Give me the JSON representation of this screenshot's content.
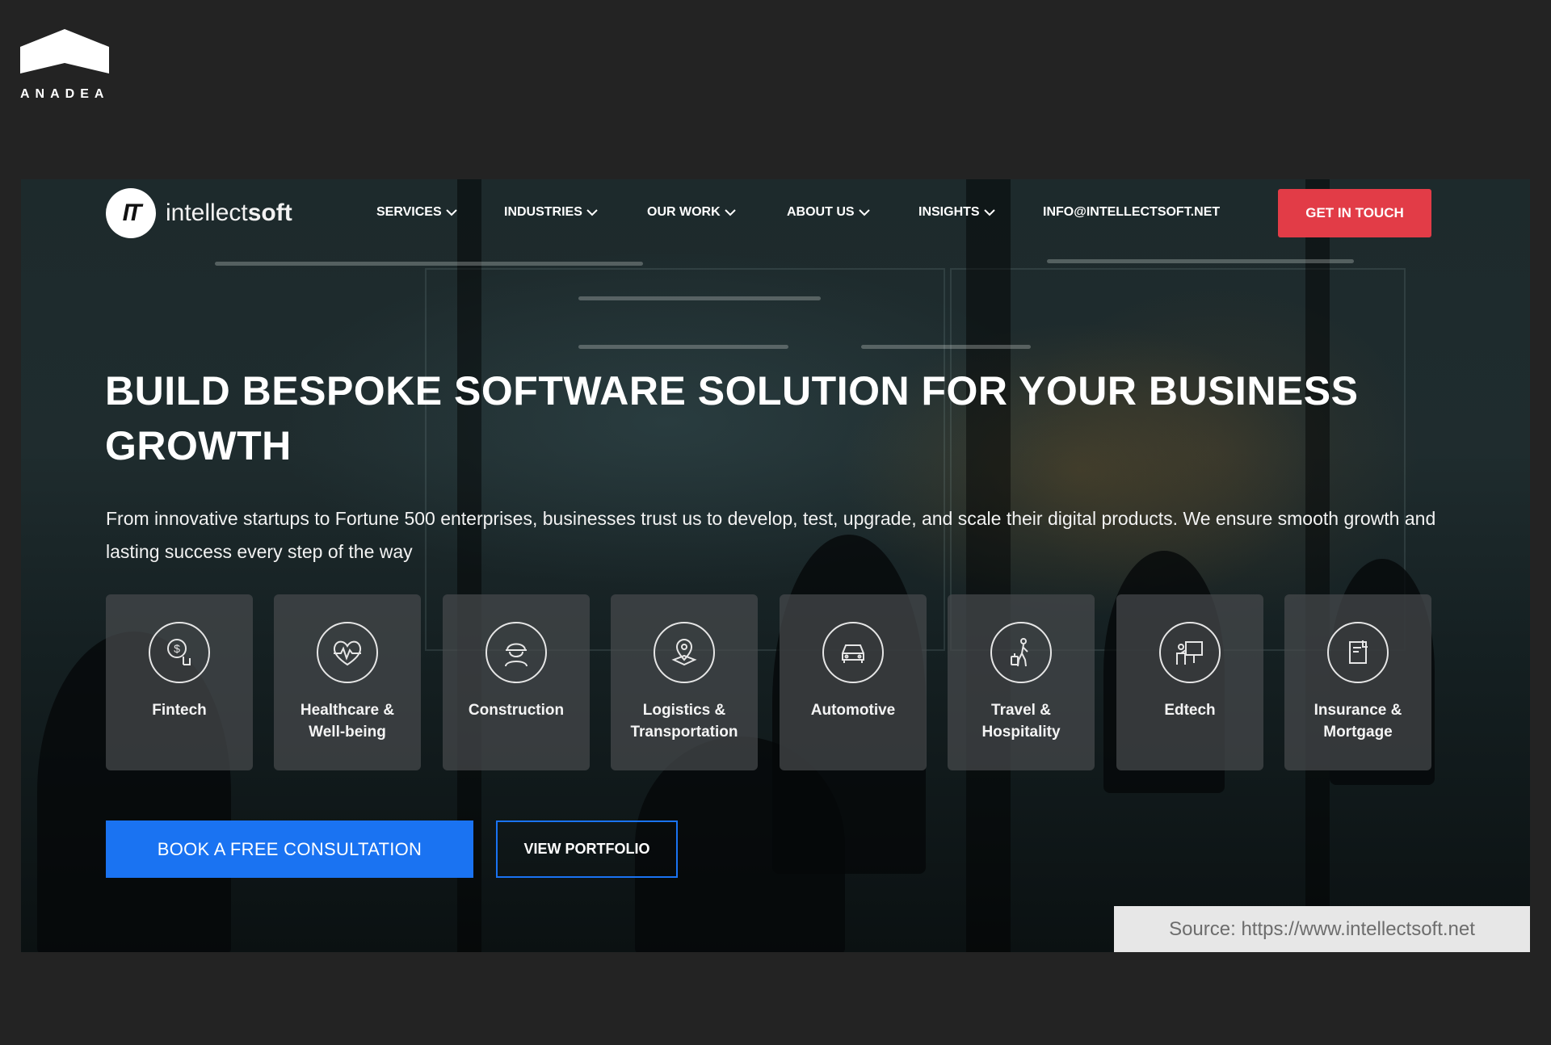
{
  "anadea": {
    "wordmark": "ANADEA"
  },
  "site": {
    "brand": {
      "badge": "IT",
      "name_light": "intellect",
      "name_bold": "soft"
    },
    "nav": [
      {
        "label": "SERVICES",
        "icon": "chevron-down-icon"
      },
      {
        "label": "INDUSTRIES",
        "icon": "chevron-down-icon"
      },
      {
        "label": "OUR WORK",
        "icon": "chevron-down-icon"
      },
      {
        "label": "ABOUT US",
        "icon": "chevron-down-icon"
      },
      {
        "label": "INSIGHTS",
        "icon": "chevron-down-icon"
      },
      {
        "label": "INFO@INTELLECTSOFT.NET"
      }
    ],
    "cta_top": "GET IN TOUCH",
    "hero": {
      "headline": "BUILD BESPOKE SOFTWARE SOLUTION FOR YOUR BUSINESS GROWTH",
      "subtext": "From innovative startups to Fortune 500 enterprises, businesses trust us to develop, test, upgrade, and scale their digital products. We ensure smooth growth and lasting success every step of the way"
    },
    "industries": [
      {
        "label": "Fintech",
        "icon": "fintech-dollar-icon"
      },
      {
        "label": "Healthcare &\nWell-being",
        "icon": "heart-pulse-icon"
      },
      {
        "label": "Construction",
        "icon": "hard-hat-worker-icon"
      },
      {
        "label": "Logistics &\nTransportation",
        "icon": "map-pin-icon"
      },
      {
        "label": "Automotive",
        "icon": "car-icon"
      },
      {
        "label": "Travel &\nHospitality",
        "icon": "traveler-luggage-icon"
      },
      {
        "label": "Edtech",
        "icon": "teacher-board-icon"
      },
      {
        "label": "Insurance &\nMortgage",
        "icon": "document-icon"
      }
    ],
    "buttons": {
      "book": "BOOK A FREE CONSULTATION",
      "portfolio": "VIEW PORTFOLIO"
    },
    "colors": {
      "cta_red": "#e23c47",
      "primary_blue": "#1a73f2"
    }
  },
  "source": "Source: https://www.intellectsoft.net"
}
